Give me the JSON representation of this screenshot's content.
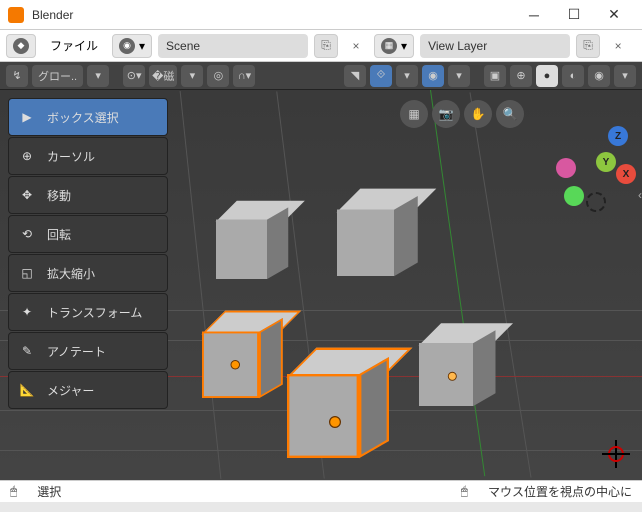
{
  "titlebar": {
    "app": "Blender"
  },
  "topbar": {
    "file": "ファイル",
    "scene_field": "Scene",
    "layer_field": "View Layer"
  },
  "header": {
    "orient_label": "グロー.."
  },
  "tools": [
    {
      "label": "ボックス選択",
      "active": true
    },
    {
      "label": "カーソル",
      "active": false
    },
    {
      "label": "移動",
      "active": false
    },
    {
      "label": "回転",
      "active": false
    },
    {
      "label": "拡大縮小",
      "active": false
    },
    {
      "label": "トランスフォーム",
      "active": false
    },
    {
      "label": "アノテート",
      "active": false
    },
    {
      "label": "メジャー",
      "active": false
    }
  ],
  "gizmo": {
    "x": "X",
    "y": "Y",
    "z": "Z"
  },
  "statusbar": {
    "left": "選択",
    "right": "マウス位置を視点の中心に"
  }
}
